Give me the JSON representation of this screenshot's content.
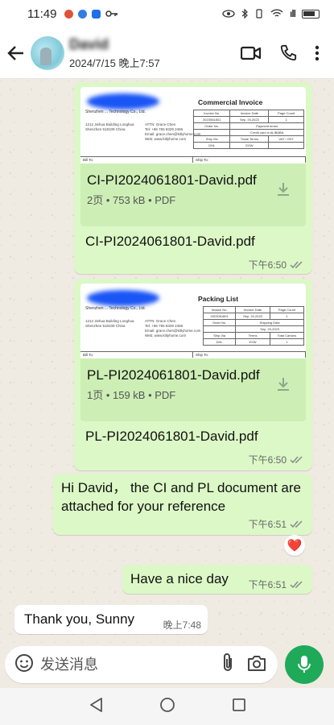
{
  "status_bar": {
    "time": "11:49",
    "signal": "ıll"
  },
  "header": {
    "contact_name": "David",
    "last_seen": "2024/7/15 晚上7:57"
  },
  "messages": {
    "ci_doc": {
      "thumb_title": "Commercial Invoice",
      "thumb_company": "Shenzhen ... Technology Co., Ltd.",
      "thumb_address": "1212 Jiehua Building Longhua Shenzhen 518109 China",
      "thumb_contact": "ATTN: Grace Chen\nTel: +86 755 8329 2466\nEmail: grace.chen@kitlyhome.com\nWeb: www.kitlyhome.com",
      "thumb_row1": [
        "Invoice No.",
        "Invoice Date",
        "Page Count"
      ],
      "thumb_row2": [
        "2023061801",
        "Sep. 20,2023",
        "1"
      ],
      "thumb_row3": [
        "Order No.",
        "Payment terms"
      ],
      "thumb_row4": [
        "",
        "Credit card in ALIBABA"
      ],
      "thumb_row5": [
        "Ship Via",
        "Trade Terms",
        "VAT / GST"
      ],
      "thumb_row6": [
        "DHL",
        "EXW",
        ""
      ],
      "thumb_bottom": [
        "Bill To:",
        "Ship To:"
      ],
      "file_name": "CI-PI2024061801-David.pdf",
      "file_meta": "2页 • 753 kB • PDF",
      "caption": "CI-PI2024061801-David.pdf",
      "time": "下午6:50"
    },
    "pl_doc": {
      "thumb_title": "Packing List",
      "thumb_company": "Shenzhen ... Technology Co., Ltd.",
      "thumb_address": "1212 Jiehua Building Longhua Shenzhen 518109 China",
      "thumb_contact": "ATTN: Grace Chen\nTel: +86 755 8329 2466\nEmail: grace.chen@kitlyhome.com\nWeb: www.kitlyhome.com",
      "thumb_row1": [
        "Invoice No.",
        "Invoice Date",
        "Page Count"
      ],
      "thumb_row2": [
        "2023061801",
        "Sep. 20,2023",
        "1"
      ],
      "thumb_row3": [
        "Order No.",
        "Shipping Date"
      ],
      "thumb_row4": [
        "",
        "Sep. 20,2023"
      ],
      "thumb_row5": [
        "Ship Via",
        "Terms",
        "Total Cartons"
      ],
      "thumb_row6": [
        "DHL",
        "EXW",
        "1"
      ],
      "thumb_bottom": [
        "Bill To:",
        "Ship To:"
      ],
      "file_name": "PL-PI2024061801-David.pdf",
      "file_meta": "1页 • 159 kB • PDF",
      "caption": "PL-PI2024061801-David.pdf",
      "time": "下午6:50"
    },
    "text1": {
      "text": "Hi David， the CI and PL document are attached for your reference",
      "time": "下午6:51",
      "reaction": "❤️"
    },
    "text2": {
      "text": "Have a nice day",
      "time": "下午6:51"
    },
    "incoming1": {
      "text": "Thank you, Sunny",
      "time": "晚上7:48"
    }
  },
  "input": {
    "placeholder": "发送消息"
  },
  "colors": {
    "outgoing_bubble": "#dcf8c6",
    "accent": "#1faa59",
    "background": "#efeae2"
  }
}
